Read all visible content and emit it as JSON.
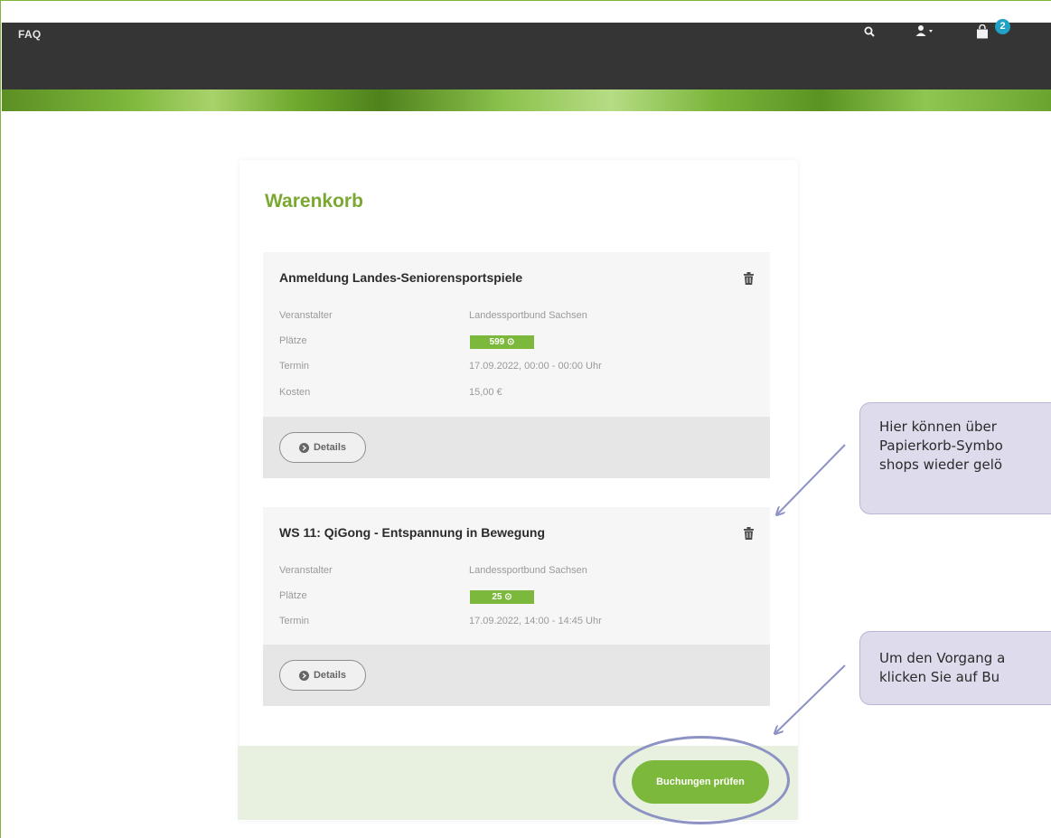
{
  "navbar": {
    "faq_label": "FAQ",
    "cart_count": "2"
  },
  "cart": {
    "title": "Warenkorb",
    "items": [
      {
        "title": "Anmeldung Landes-Seniorensportspiele",
        "rows": [
          {
            "label": "Veranstalter",
            "value": "Landessportbund Sachsen"
          },
          {
            "label": "Plätze",
            "badge": "599"
          },
          {
            "label": "Termin",
            "value": "17.09.2022, 00:00 - 00:00 Uhr"
          },
          {
            "label": "Kosten",
            "value": "15,00 €"
          }
        ],
        "details_label": "Details"
      },
      {
        "title": "WS 11: QiGong - Entspannung in Bewegung",
        "rows": [
          {
            "label": "Veranstalter",
            "value": "Landessportbund Sachsen"
          },
          {
            "label": "Plätze",
            "badge": "25"
          },
          {
            "label": "Termin",
            "value": "17.09.2022, 14:00 - 14:45 Uhr"
          }
        ],
        "details_label": "Details"
      }
    ],
    "submit_label": "Buchungen prüfen"
  },
  "callouts": [
    {
      "lines": [
        "Hier können über",
        "Papierkorb-Symbo",
        "shops wieder gelö"
      ]
    },
    {
      "lines": [
        "Um den Vorgang a",
        "klicken Sie auf Bu"
      ]
    }
  ],
  "colors": {
    "brand_green": "#7cb83b",
    "title_green": "#7aa830",
    "navbar": "#353535",
    "badge_blue": "#21a1c4",
    "callout_bg": "#dedcec",
    "annotation": "#8c92c4"
  },
  "icons": {
    "search": "search-icon",
    "user": "user-icon",
    "cart": "shopping-bag-icon",
    "delete": "trash-icon",
    "details": "chevron-circle-right-icon",
    "places": "places-circle-icon"
  }
}
